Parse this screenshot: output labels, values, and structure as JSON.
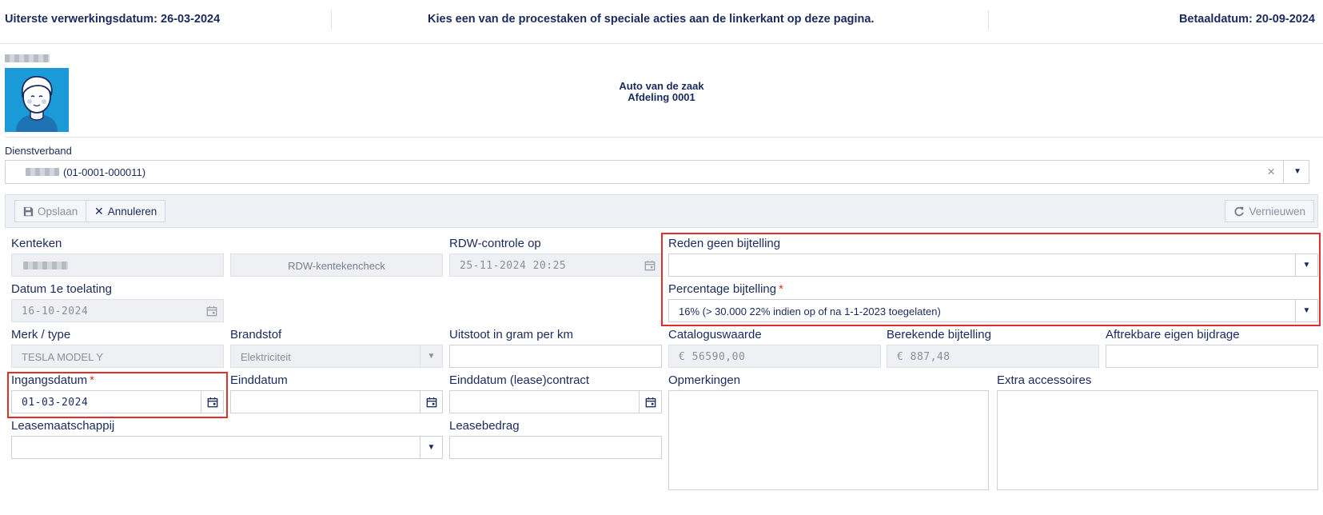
{
  "header": {
    "deadline": "Uiterste verwerkingsdatum: 26-03-2024",
    "instruction": "Kies een van de procestaken of speciale acties aan de linkerkant op deze pagina.",
    "paydate": "Betaaldatum: 20-09-2024"
  },
  "profile": {
    "title": "Auto van de zaak",
    "department": "Afdeling 0001"
  },
  "employment": {
    "label": "Dienstverband",
    "value": "(01-0001-000011)"
  },
  "toolbar": {
    "save_label": "Opslaan",
    "cancel_label": "Annuleren",
    "refresh_label": "Vernieuwen"
  },
  "form": {
    "kenteken_label": "Kenteken",
    "rdw_check_button": "RDW-kentekencheck",
    "rdw_control_label": "RDW-controle op",
    "rdw_control_value": "25-11-2024 20:25",
    "reden_label": "Reden geen bijtelling",
    "reden_value": "",
    "datum_toelating_label": "Datum 1e toelating",
    "datum_toelating_value": "16-10-2024",
    "percentage_label": "Percentage bijtelling",
    "percentage_value": "16% (> 30.000 22% indien op of na 1-1-2023 toegelaten)",
    "merk_label": "Merk / type",
    "merk_value": "TESLA MODEL Y",
    "brandstof_label": "Brandstof",
    "brandstof_value": "Elektriciteit",
    "uitstoot_label": "Uitstoot in gram per km",
    "uitstoot_value": "",
    "catalogus_label": "Cataloguswaarde",
    "catalogus_value": "€ 56590,00",
    "berekend_label": "Berekende bijtelling",
    "berekend_value": "€ 887,48",
    "aftrekbaar_label": "Aftrekbare eigen bijdrage",
    "aftrekbaar_value": "",
    "ingang_label": "Ingangsdatum",
    "ingang_value": "01-03-2024",
    "eind_label": "Einddatum",
    "eind_value": "",
    "eind_lease_label": "Einddatum (lease)contract",
    "eind_lease_value": "",
    "opmerkingen_label": "Opmerkingen",
    "extra_label": "Extra accessoires",
    "leasemaatschappij_label": "Leasemaatschappij",
    "leasemaatschappij_value": "",
    "leasebedrag_label": "Leasebedrag",
    "leasebedrag_value": ""
  },
  "colors": {
    "primary_text": "#1b2a5c",
    "avatar_bg": "#1a9ad6",
    "required": "#e0332d",
    "highlight_box": "#e0302b"
  }
}
